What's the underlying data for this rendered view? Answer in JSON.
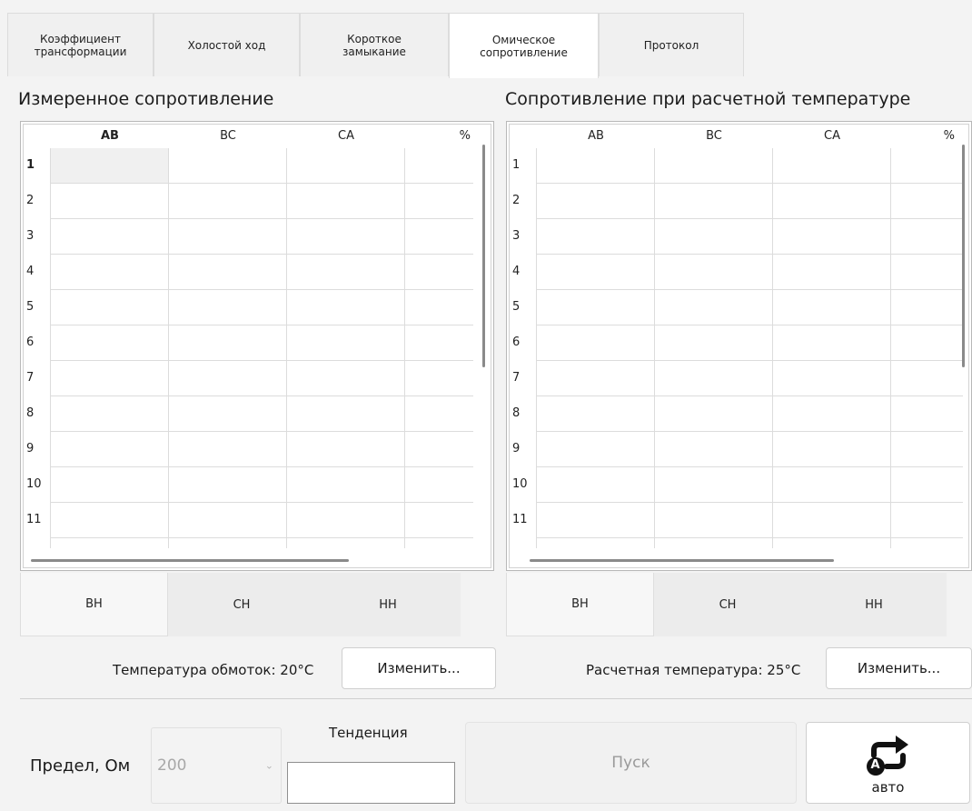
{
  "tabs": [
    {
      "label": "Коэффициент\nтрансформации",
      "active": false
    },
    {
      "label": "Холостой ход",
      "active": false
    },
    {
      "label": "Короткое\nзамыкание",
      "active": false
    },
    {
      "label": "Омическое\nсопротивление",
      "active": true
    },
    {
      "label": "Протокол",
      "active": false
    }
  ],
  "left_panel": {
    "title": "Измеренное сопротивление",
    "columns": [
      "AB",
      "BC",
      "CA",
      "%"
    ],
    "rows": [
      "1",
      "2",
      "3",
      "4",
      "5",
      "6",
      "7",
      "8",
      "9",
      "10",
      "11"
    ],
    "subtabs": [
      "ВН",
      "СН",
      "НН"
    ],
    "temp_label": "Температура обмоток: 20°C",
    "change_button": "Изменить..."
  },
  "right_panel": {
    "title": "Сопротивление при расчетной температуре",
    "columns": [
      "AB",
      "BC",
      "CA",
      "%"
    ],
    "rows": [
      "1",
      "2",
      "3",
      "4",
      "5",
      "6",
      "7",
      "8",
      "9",
      "10",
      "11"
    ],
    "subtabs": [
      "ВН",
      "СН",
      "НН"
    ],
    "temp_label": "Расчетная температура: 25°C",
    "change_button": "Изменить..."
  },
  "bottom": {
    "limit_label": "Предел, Ом",
    "limit_value": "200",
    "trend_label": "Тенденция",
    "start_button": "Пуск",
    "auto_button": "авто",
    "auto_badge": "A"
  },
  "colors": {
    "accent_dark": "#111111",
    "disabled_text": "#9a9a9a"
  }
}
